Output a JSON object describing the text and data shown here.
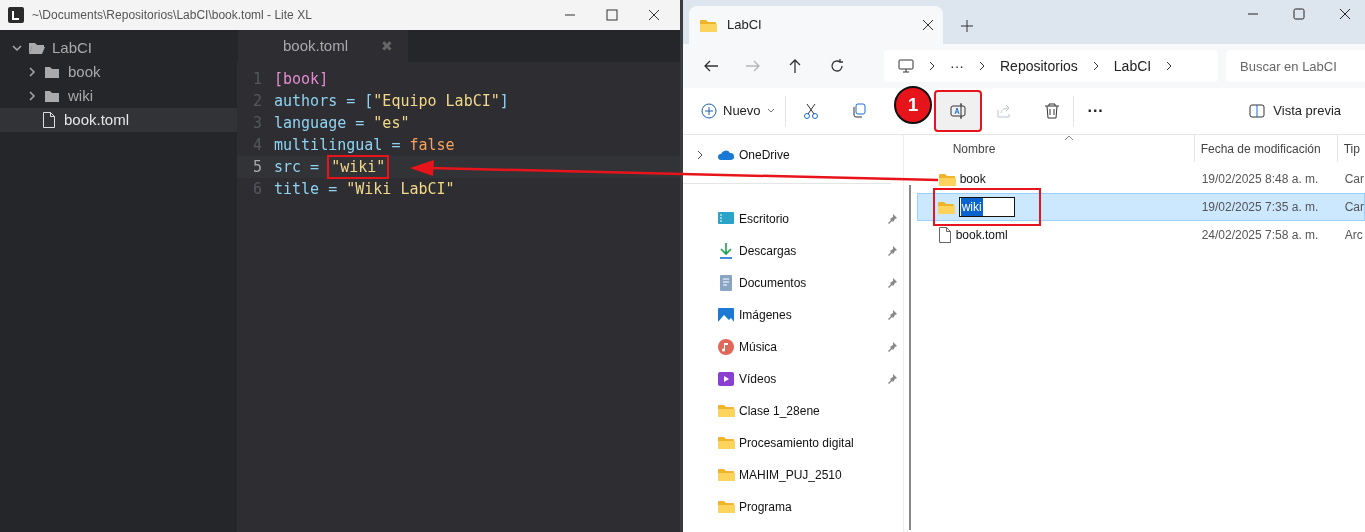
{
  "editor": {
    "title": "~\\Documents\\Repositorios\\LabCI\\book.toml - Lite XL",
    "tree": {
      "label": "LabCI",
      "expanded": true,
      "children": [
        {
          "label": "book",
          "kind": "folder",
          "selected": false
        },
        {
          "label": "wiki",
          "kind": "folder",
          "selected": false
        },
        {
          "label": "book.toml",
          "kind": "file",
          "selected": true
        }
      ]
    },
    "tab": {
      "label": "book.toml",
      "close": "✖"
    },
    "lines": [
      {
        "number": "1",
        "current": false,
        "tokens": [
          {
            "kind": "section",
            "text": "[book]"
          }
        ]
      },
      {
        "number": "2",
        "current": false,
        "tokens": [
          {
            "kind": "key",
            "text": "authors = ["
          },
          {
            "kind": "string",
            "text": "\"Equipo LabCI\""
          },
          {
            "kind": "key",
            "text": "]"
          }
        ]
      },
      {
        "number": "3",
        "current": false,
        "tokens": [
          {
            "kind": "key",
            "text": "language = "
          },
          {
            "kind": "string",
            "text": "\"es\""
          }
        ]
      },
      {
        "number": "4",
        "current": false,
        "tokens": [
          {
            "kind": "key",
            "text": "multilingual = "
          },
          {
            "kind": "bool",
            "text": "false"
          }
        ]
      },
      {
        "number": "5",
        "current": true,
        "tokens": [
          {
            "kind": "key",
            "text": "src = "
          },
          {
            "kind": "string",
            "text": "\"wiki\"",
            "boxed": true
          }
        ]
      },
      {
        "number": "6",
        "current": false,
        "tokens": [
          {
            "kind": "key",
            "text": "title = "
          },
          {
            "kind": "string",
            "text": "\"Wiki LabCI\""
          }
        ]
      }
    ]
  },
  "explorer": {
    "tab": {
      "title": "LabCI"
    },
    "nav": [
      {
        "kind": "back",
        "disabled": false
      },
      {
        "kind": "forward",
        "disabled": true
      },
      {
        "kind": "up",
        "disabled": false
      },
      {
        "kind": "refresh",
        "disabled": false
      }
    ],
    "breadcrumb": [
      "···",
      "Repositorios",
      "LabCI"
    ],
    "search": {
      "placeholder": "Buscar en LabCI"
    },
    "toolbar": {
      "new_label": "Nuevo",
      "actions": [
        {
          "kind": "cut",
          "disabled": false,
          "boxed": false
        },
        {
          "kind": "copy",
          "disabled": false,
          "boxed": false
        },
        {
          "kind": "rename",
          "disabled": false,
          "boxed": true
        },
        {
          "kind": "share",
          "disabled": true,
          "boxed": false
        },
        {
          "kind": "delete",
          "disabled": false,
          "boxed": false
        }
      ],
      "more": "···",
      "preview_label": "Vista previa"
    },
    "step_badge": "1",
    "sidebar": [
      {
        "label": "OneDrive",
        "kind": "cloud",
        "pinned": false,
        "expandable": true
      },
      {
        "label": "Escritorio",
        "kind": "desktop",
        "pinned": true,
        "expandable": false
      },
      {
        "label": "Descargas",
        "kind": "download",
        "pinned": true,
        "expandable": false
      },
      {
        "label": "Documentos",
        "kind": "document",
        "pinned": true,
        "expandable": false
      },
      {
        "label": "Imágenes",
        "kind": "pictures",
        "pinned": true,
        "expandable": false
      },
      {
        "label": "Música",
        "kind": "music",
        "pinned": true,
        "expandable": false
      },
      {
        "label": "Vídeos",
        "kind": "video",
        "pinned": true,
        "expandable": false
      },
      {
        "label": "Clase 1_28ene",
        "kind": "folder",
        "pinned": false,
        "expandable": false
      },
      {
        "label": "Procesamiento digital",
        "kind": "folder",
        "pinned": false,
        "expandable": false
      },
      {
        "label": "MAHIM_PUJ_2510",
        "kind": "folder",
        "pinned": false,
        "expandable": false
      },
      {
        "label": "Programa",
        "kind": "folder",
        "pinned": false,
        "expandable": false
      }
    ],
    "columns": [
      "Nombre",
      "Fecha de modificación",
      "Tip"
    ],
    "rows": [
      {
        "name": "book",
        "kind": "folder",
        "date": "19/02/2025 8:48 a. m.",
        "type": "Car",
        "selected": false,
        "renaming": false
      },
      {
        "name": "wiki",
        "kind": "folder",
        "date": "19/02/2025 7:35 a. m.",
        "type": "Car",
        "selected": true,
        "renaming": true
      },
      {
        "name": "book.toml",
        "kind": "file",
        "date": "24/02/2025 7:58 a. m.",
        "type": "Arc",
        "selected": false,
        "renaming": false
      }
    ]
  }
}
